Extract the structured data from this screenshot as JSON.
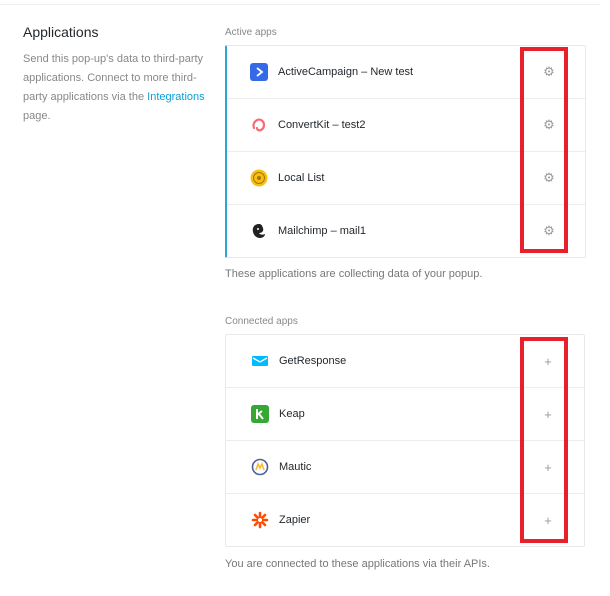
{
  "applications": {
    "title": "Applications",
    "description_prefix": "Send this pop-up's data to third-party applications. Connect to more third-party applications via the ",
    "link_text": "Integrations",
    "description_suffix": " page."
  },
  "active": {
    "label": "Active apps",
    "items": [
      {
        "name": "ActiveCampaign – New test",
        "icon": "activecampaign-icon"
      },
      {
        "name": "ConvertKit – test2",
        "icon": "convertkit-icon"
      },
      {
        "name": "Local List",
        "icon": "local-list-icon"
      },
      {
        "name": "Mailchimp – mail1",
        "icon": "mailchimp-icon"
      }
    ],
    "help": "These applications are collecting data of your popup."
  },
  "connected": {
    "label": "Connected apps",
    "items": [
      {
        "name": "GetResponse",
        "icon": "getresponse-icon"
      },
      {
        "name": "Keap",
        "icon": "keap-icon"
      },
      {
        "name": "Mautic",
        "icon": "mautic-icon"
      },
      {
        "name": "Zapier",
        "icon": "zapier-icon"
      }
    ],
    "help": "You are connected to these applications via their APIs."
  },
  "colors": {
    "link": "#0b9ed6",
    "active_accent": "#2aa7d6",
    "highlight": "#e8202a"
  }
}
